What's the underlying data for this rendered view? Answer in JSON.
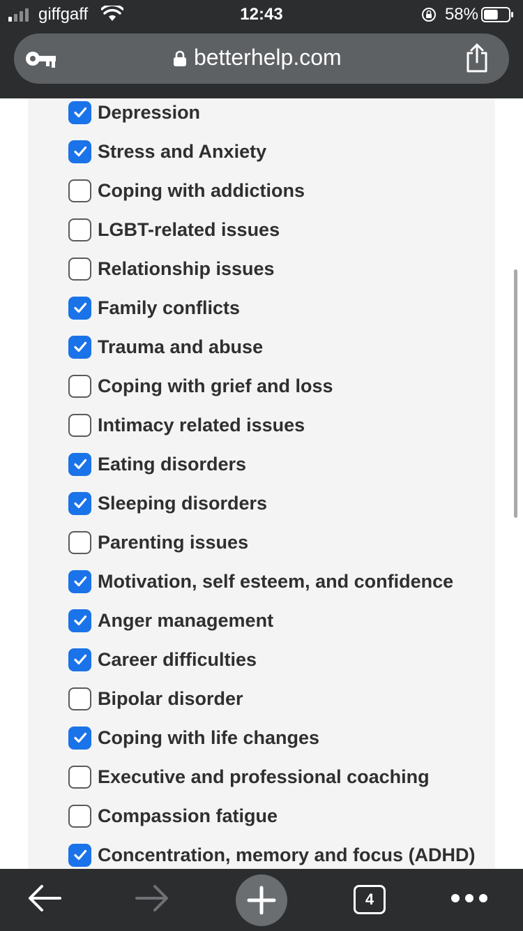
{
  "status_bar": {
    "carrier": "giffgaff",
    "time": "12:43",
    "battery_percent": "58%",
    "battery_level": 0.58
  },
  "address_bar": {
    "url": "betterhelp.com"
  },
  "checklist": [
    {
      "label": "Depression",
      "checked": true
    },
    {
      "label": "Stress and Anxiety",
      "checked": true
    },
    {
      "label": "Coping with addictions",
      "checked": false
    },
    {
      "label": "LGBT-related issues",
      "checked": false
    },
    {
      "label": "Relationship issues",
      "checked": false
    },
    {
      "label": "Family conflicts",
      "checked": true
    },
    {
      "label": "Trauma and abuse",
      "checked": true
    },
    {
      "label": "Coping with grief and loss",
      "checked": false
    },
    {
      "label": "Intimacy related issues",
      "checked": false
    },
    {
      "label": "Eating disorders",
      "checked": true
    },
    {
      "label": "Sleeping disorders",
      "checked": true
    },
    {
      "label": "Parenting issues",
      "checked": false
    },
    {
      "label": "Motivation, self esteem, and confidence",
      "checked": true
    },
    {
      "label": "Anger management",
      "checked": true
    },
    {
      "label": "Career difficulties",
      "checked": true
    },
    {
      "label": "Bipolar disorder",
      "checked": false
    },
    {
      "label": "Coping with life changes",
      "checked": true
    },
    {
      "label": "Executive and professional coaching",
      "checked": false
    },
    {
      "label": "Compassion fatigue",
      "checked": false
    },
    {
      "label": "Concentration, memory and focus (ADHD)",
      "checked": true
    }
  ],
  "toolbar": {
    "tab_count": "4"
  },
  "colors": {
    "accent": "#1a73e8",
    "chrome": "#2b2d2f",
    "panel": "#f4f4f5"
  },
  "icons": {
    "back": "arrow-left-icon",
    "forward": "arrow-right-icon",
    "new_tab": "plus-icon",
    "tabs": "tab-count-icon",
    "more": "more-dots-icon",
    "share": "share-icon",
    "password": "key-icon",
    "secure": "lock-icon"
  }
}
